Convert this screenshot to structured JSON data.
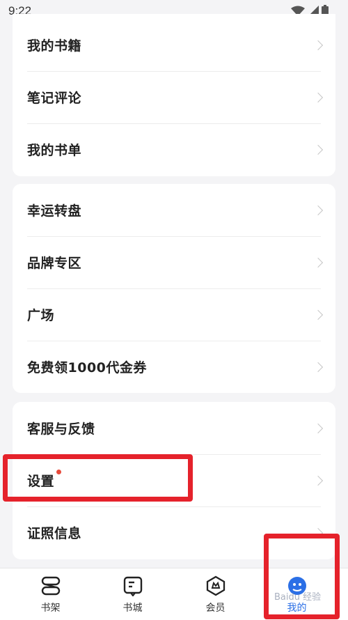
{
  "status_bar": {
    "time": "9:22"
  },
  "sections": [
    {
      "items": [
        {
          "label": "我的书籍"
        },
        {
          "label": "笔记评论"
        },
        {
          "label": "我的书单"
        }
      ]
    },
    {
      "items": [
        {
          "label": "幸运转盘"
        },
        {
          "label": "品牌专区"
        },
        {
          "label": "广场"
        },
        {
          "label": "免费领1000代金券"
        }
      ]
    },
    {
      "items": [
        {
          "label": "客服与反馈"
        },
        {
          "label": "设置",
          "has_red_dot": true
        },
        {
          "label": "证照信息"
        }
      ]
    }
  ],
  "bottom_nav": {
    "items": [
      {
        "label": "书架",
        "icon": "bookshelf-icon"
      },
      {
        "label": "书城",
        "icon": "bookstore-icon"
      },
      {
        "label": "会员",
        "icon": "membership-icon"
      },
      {
        "label": "我的",
        "icon": "profile-icon",
        "active": true
      }
    ]
  },
  "colors": {
    "accent": "#2b6fe6",
    "highlight": "#e5222b",
    "red_dot": "#e84b3c",
    "background": "#f4f4f6"
  },
  "watermark": "Baidu 经验"
}
